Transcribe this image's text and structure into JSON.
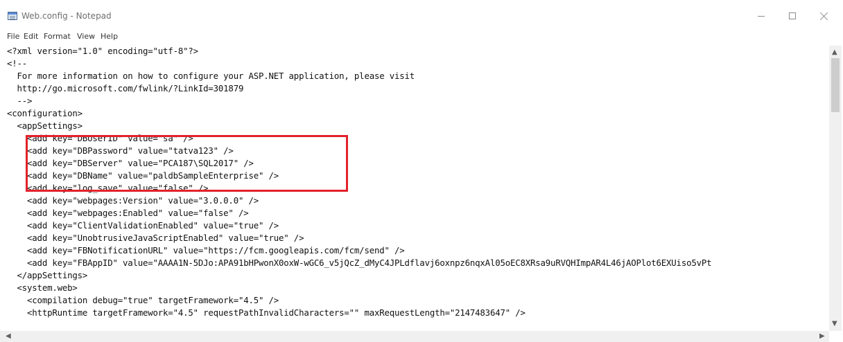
{
  "window": {
    "title": "Web.config - Notepad",
    "icon": "notepad-icon",
    "controls": {
      "minimize": "minimize-icon",
      "maximize": "maximize-icon",
      "close": "close-icon"
    }
  },
  "menu": [
    "File",
    "Edit",
    "Format",
    "View",
    "Help"
  ],
  "editor": {
    "lines": [
      "<?xml version=\"1.0\" encoding=\"utf-8\"?>",
      "<!--",
      "  For more information on how to configure your ASP.NET application, please visit",
      "  http://go.microsoft.com/fwlink/?LinkId=301879",
      "  -->",
      "<configuration>",
      "  <appSettings>",
      "    <add key=\"DBUserID\" value=\"sa\" />",
      "    <add key=\"DBPassword\" value=\"tatva123\" />",
      "    <add key=\"DBServer\" value=\"PCA187\\SQL2017\" />",
      "    <add key=\"DBName\" value=\"paldbSampleEnterprise\" />",
      "    <add key=\"log_save\" value=\"false\" />",
      "    <add key=\"webpages:Version\" value=\"3.0.0.0\" />",
      "    <add key=\"webpages:Enabled\" value=\"false\" />",
      "    <add key=\"ClientValidationEnabled\" value=\"true\" />",
      "    <add key=\"UnobtrusiveJavaScriptEnabled\" value=\"true\" />",
      "    <add key=\"FBNotificationURL\" value=\"https://fcm.googleapis.com/fcm/send\" />",
      "    <add key=\"FBAppID\" value=\"AAAA1N-5DJo:APA91bHPwonX0oxW-wGC6_v5jQcZ_dMyC4JPLdflavj6oxnpz6nqxAl05oEC8XRsa9uRVQHImpAR4L46jAOPlot6EXUiso5vPt",
      "  </appSettings>",
      "  <system.web>",
      "    <compilation debug=\"true\" targetFramework=\"4.5\" />",
      "    <httpRuntime targetFramework=\"4.5\" requestPathInvalidCharacters=\"\" maxRequestLength=\"2147483647\" />"
    ],
    "highlight_color": "#e3212b"
  },
  "scrollbars": {
    "up": "▲",
    "down": "▼",
    "left": "◀",
    "right": "▶"
  }
}
